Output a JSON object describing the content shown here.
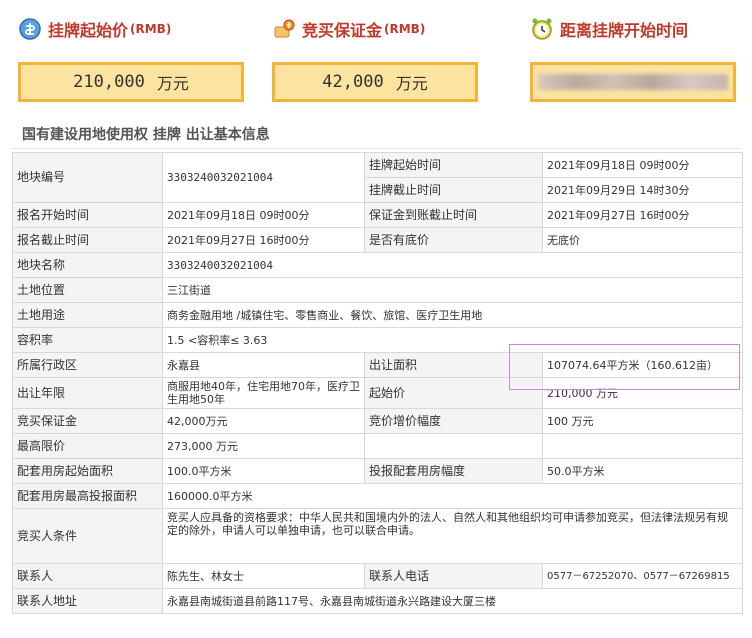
{
  "cards": [
    {
      "title": "挂牌起始价",
      "unit_tag": "(RMB)",
      "value": "210,000",
      "unit": "万元",
      "icon": "price-tag-icon"
    },
    {
      "title": "竞买保证金",
      "unit_tag": "(RMB)",
      "value": "42,000",
      "unit": "万元",
      "icon": "deposit-icon"
    },
    {
      "title": "距离挂牌开始时间",
      "unit_tag": "",
      "value": "",
      "unit": "",
      "icon": "alarm-clock-icon"
    }
  ],
  "section_title": "国有建设用地使用权 挂牌 出让基本信息",
  "table": {
    "parcel_no_label": "地块编号",
    "parcel_no": "3303240032021004",
    "listing_start_label": "挂牌起始时间",
    "listing_start": "2021年09月18日 09时00分",
    "listing_end_label": "挂牌截止时间",
    "listing_end": "2021年09月29日 14时30分",
    "reg_start_label": "报名开始时间",
    "reg_start": "2021年09月18日 09时00分",
    "deposit_deadline_label": "保证金到账截止时间",
    "deposit_deadline": "2021年09月27日 16时00分",
    "reg_end_label": "报名截止时间",
    "reg_end": "2021年09月27日 16时00分",
    "reserve_label": "是否有底价",
    "reserve": "无底价",
    "parcel_name_label": "地块名称",
    "parcel_name": "3303240032021004",
    "location_label": "土地位置",
    "location": "三江街道",
    "usage_label": "土地用途",
    "usage": "商务金融用地 /城镇住宅、零售商业、餐饮、旅馆、医疗卫生用地",
    "far_label": "容积率",
    "far": "1.5 <容积率≤ 3.63",
    "district_label": "所属行政区",
    "district": "永嘉县",
    "area_label": "出让面积",
    "area": "107074.64平方米（160.612亩）",
    "term_label": "出让年限",
    "term": "商服用地40年，住宅用地70年，医疗卫生用地50年",
    "start_price_label": "起始价",
    "start_price": "210,000 万元",
    "bid_deposit_label": "竞买保证金",
    "bid_deposit": "42,000万元",
    "increment_label": "竞价增价幅度",
    "increment": "100 万元",
    "max_price_label": "最高限价",
    "max_price": "273,000 万元",
    "housing_start_label": "配套用房起始面积",
    "housing_start": "100.0平方米",
    "housing_incr_label": "投报配套用房幅度",
    "housing_incr": "50.0平方米",
    "housing_max_label": "配套用房最高投报面积",
    "housing_max": "160000.0平方米",
    "bidder_cond_label": "竞买人条件",
    "bidder_cond": "竞买人应具备的资格要求：中华人民共和国境内外的法人、自然人和其他组织均可申请参加竞买，但法律法规另有规定的除外，申请人可以单独申请，也可以联合申请。",
    "contact_label": "联系人",
    "contact": "陈先生、林女士",
    "phone_label": "联系人电话",
    "phone": "0577－67252070、0577－67269815",
    "address_label": "联系人地址",
    "address": "永嘉县南城街道县前路117号、永嘉县南城街道永兴路建设大厦三楼"
  },
  "colors": {
    "accent": "#c0392b",
    "card_fill": "#fde3a0",
    "card_border": "#f3b43a",
    "highlight": "#c78ad6"
  }
}
